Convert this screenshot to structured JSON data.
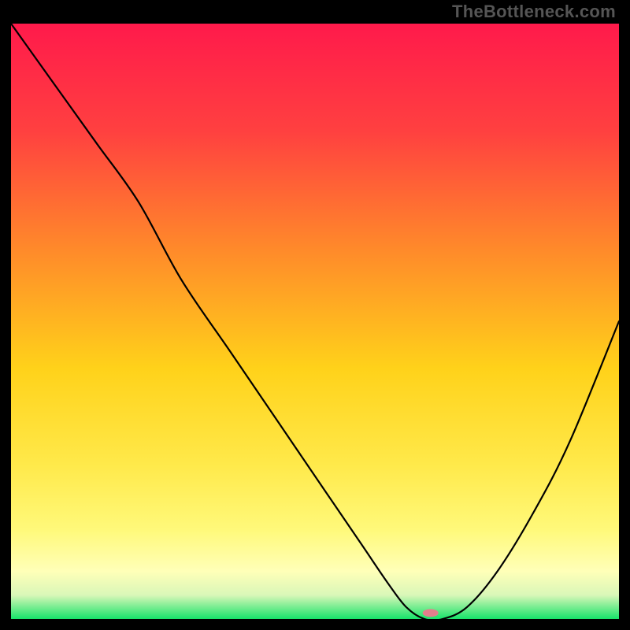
{
  "watermark": "TheBottleneck.com",
  "chart_data": {
    "type": "line",
    "title": "",
    "xlabel": "",
    "ylabel": "",
    "xlim": [
      0,
      100
    ],
    "ylim": [
      0,
      100
    ],
    "gradient_stops": [
      {
        "offset": 0,
        "color": "#ff1a4b"
      },
      {
        "offset": 18,
        "color": "#ff4040"
      },
      {
        "offset": 38,
        "color": "#ff8a2a"
      },
      {
        "offset": 58,
        "color": "#ffd21a"
      },
      {
        "offset": 74,
        "color": "#ffe94a"
      },
      {
        "offset": 85,
        "color": "#fff97a"
      },
      {
        "offset": 92,
        "color": "#ffffb8"
      },
      {
        "offset": 96,
        "color": "#d9f7b8"
      },
      {
        "offset": 100,
        "color": "#17e36a"
      }
    ],
    "series": [
      {
        "name": "bottleneck-curve",
        "x": [
          0,
          7,
          14,
          21,
          28,
          36,
          44,
          52,
          58,
          62,
          65,
          68,
          71,
          75,
          80,
          86,
          92,
          100
        ],
        "values": [
          100,
          90,
          80,
          70,
          57,
          45,
          33,
          21,
          12,
          6,
          2,
          0,
          0,
          2,
          8,
          18,
          30,
          50
        ]
      }
    ],
    "marker": {
      "name": "optimal-point",
      "x": 69,
      "y": 1,
      "color": "#e37f8c",
      "rx": 10,
      "ry": 5
    }
  }
}
